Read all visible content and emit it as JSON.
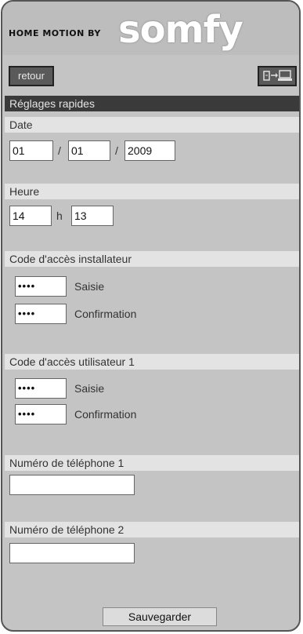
{
  "header": {
    "brand_prefix": "HOME MOTION BY",
    "brand_name": "somfy"
  },
  "toolbar": {
    "back_label": "retour",
    "transfer_icon": "device-transfer-icon"
  },
  "section_title": "Réglages rapides",
  "date": {
    "label": "Date",
    "day": "01",
    "month": "01",
    "year": "2009",
    "separator": "/"
  },
  "time": {
    "label": "Heure",
    "hour": "14",
    "minute": "13",
    "separator": "h"
  },
  "installer_code": {
    "label": "Code d'accès installateur",
    "entry_value": "••••",
    "entry_label": "Saisie",
    "confirm_value": "••••",
    "confirm_label": "Confirmation"
  },
  "user_code": {
    "label": "Code d'accès utilisateur 1",
    "entry_value": "••••",
    "entry_label": "Saisie",
    "confirm_value": "••••",
    "confirm_label": "Confirmation"
  },
  "phone1": {
    "label": "Numéro de téléphone 1",
    "value": ""
  },
  "phone2": {
    "label": "Numéro de téléphone 2",
    "value": ""
  },
  "save_label": "Sauvegarder"
}
